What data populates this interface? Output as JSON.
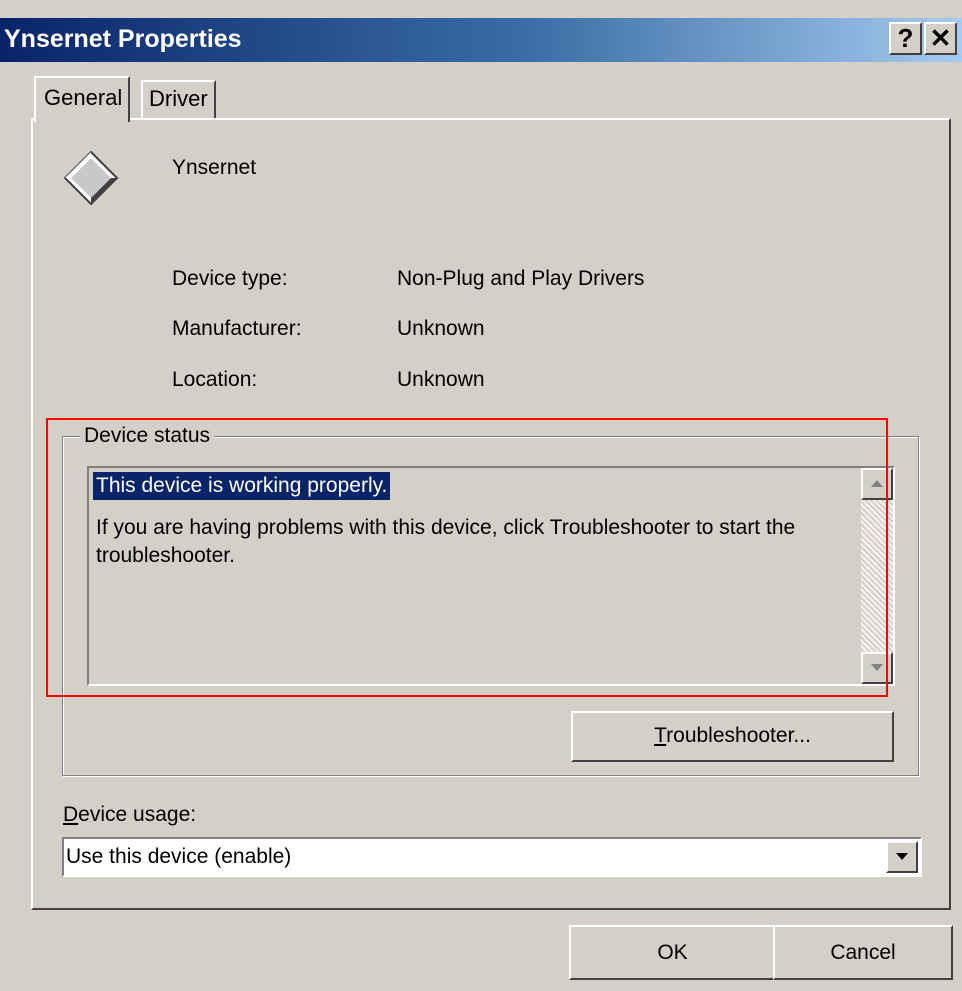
{
  "window": {
    "title": "Ynsernet Properties",
    "help_glyph": "?",
    "close_glyph": "✕"
  },
  "tabs": [
    {
      "label": "General",
      "selected": true
    },
    {
      "label": "Driver",
      "selected": false
    }
  ],
  "device": {
    "name": "Ynsernet",
    "icon": "diamond-device-icon",
    "fields": [
      {
        "label": "Device type:",
        "value": "Non-Plug and Play Drivers"
      },
      {
        "label": "Manufacturer:",
        "value": "Unknown"
      },
      {
        "label": "Location:",
        "value": "Unknown"
      }
    ]
  },
  "status": {
    "group_label": "Device status",
    "line1": "This device is working properly.",
    "line2": "If you are having problems with this device, click Troubleshooter to start the troubleshooter."
  },
  "buttons": {
    "troubleshooter_first": "T",
    "troubleshooter_rest": "roubleshooter...",
    "ok": "OK",
    "cancel": "Cancel"
  },
  "usage": {
    "label_first": "D",
    "label_rest": "evice usage:",
    "selected": "Use this device (enable)"
  },
  "colors": {
    "titlebar_start": "#0a246a",
    "titlebar_end": "#a6caf0",
    "face": "#d4d0c8",
    "selection": "#0a246a",
    "highlight_box": "#ff0000"
  }
}
